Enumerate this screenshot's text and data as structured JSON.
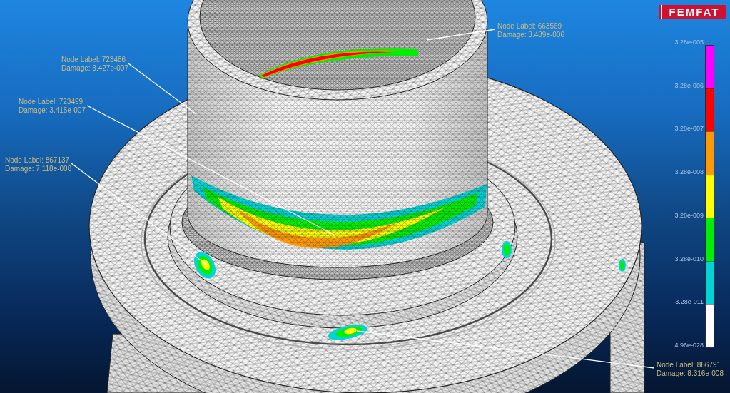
{
  "logo": {
    "text": "FEMFAT"
  },
  "annotations": [
    {
      "node_label": "Node Label: 663569",
      "damage": "Damage: 3.489e-006"
    },
    {
      "node_label": "Node Label: 723486",
      "damage": "Damage: 3.427e-007"
    },
    {
      "node_label": "Node Label: 723499",
      "damage": "Damage: 3.415e-007"
    },
    {
      "node_label": "Node Label: 867137",
      "damage": "Damage: 7.118e-008"
    },
    {
      "node_label": "Node Label: 866791",
      "damage": "Damage: 8.316e-008"
    }
  ],
  "legend": {
    "ticks": [
      "3.28e-005",
      "3.28e-006",
      "3.28e-007",
      "3.28e-008",
      "3.28e-009",
      "3.28e-010",
      "3.28e-011",
      "4.96e-028"
    ],
    "segments": [
      {
        "color": "#ff00ff"
      },
      {
        "color": "#ff0000"
      },
      {
        "color": "#ff9900"
      },
      {
        "color": "#ffff00"
      },
      {
        "color": "#00ee00"
      },
      {
        "color": "#00d4d4"
      },
      {
        "color": "#ffffff"
      }
    ]
  }
}
